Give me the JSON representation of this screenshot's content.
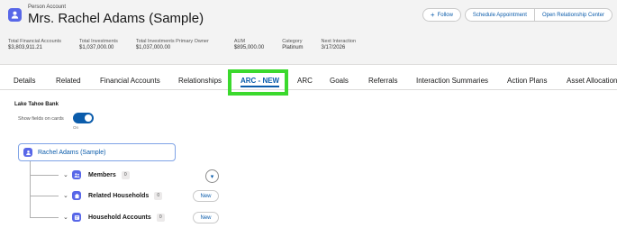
{
  "header": {
    "record_type": "Person Account",
    "record_name": "Mrs. Rachel Adams (Sample)",
    "buttons": {
      "follow": "Follow",
      "schedule": "Schedule Appointment",
      "relationship_center": "Open Relationship Center"
    },
    "fields": [
      {
        "label": "Total Financial Accounts",
        "value": "$3,803,911.21"
      },
      {
        "label": "Total Investments",
        "value": "$1,037,000.00"
      },
      {
        "label": "Total Investments Primary Owner",
        "value": "$1,037,000.00"
      },
      {
        "label": "AUM",
        "value": "$895,000.00"
      },
      {
        "label": "Category",
        "value": "Platinum"
      },
      {
        "label": "Next Interaction",
        "value": "3/17/2026"
      }
    ]
  },
  "tabs": [
    {
      "label": "Details"
    },
    {
      "label": "Related"
    },
    {
      "label": "Financial Accounts"
    },
    {
      "label": "Relationships"
    },
    {
      "label": "ARC - NEW"
    },
    {
      "label": "ARC"
    },
    {
      "label": "Goals"
    },
    {
      "label": "Referrals"
    },
    {
      "label": "Interaction Summaries"
    },
    {
      "label": "Action Plans"
    },
    {
      "label": "Asset Allocation"
    }
  ],
  "active_tab": "ARC - NEW",
  "arc": {
    "bank": "Lake Tahoe Bank",
    "show_fields_label": "Show fields on cards",
    "toggle_state": "On",
    "root": "Rachel Adams (Sample)",
    "children": [
      {
        "label": "Members",
        "count": "0",
        "action": "▾"
      },
      {
        "label": "Related Households",
        "count": "0",
        "action": "New"
      },
      {
        "label": "Household Accounts",
        "count": "0",
        "action": "New"
      }
    ]
  },
  "colors": {
    "brand": "#0b5cab",
    "icon": "#5867e8",
    "highlight": "#3bd92d"
  }
}
